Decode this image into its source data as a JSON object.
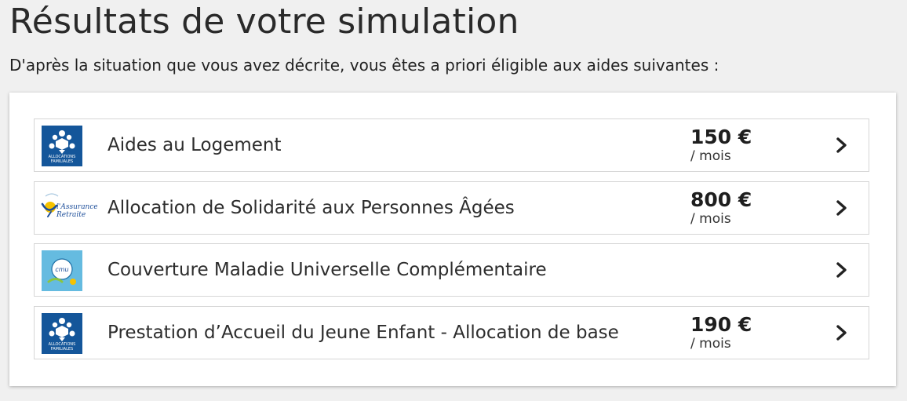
{
  "page": {
    "title": "Résultats de votre simulation",
    "subtitle": "D'après la situation que vous avez décrite, vous êtes a priori éligible aux aides suivantes :"
  },
  "aids": [
    {
      "name": "Aides au Logement",
      "amount": "150 €",
      "period": "/ mois",
      "logo": "caf-logo",
      "logo_text": "ALLOCATIONS FAMILIALES"
    },
    {
      "name": "Allocation de Solidarité aux Personnes Âgées",
      "amount": "800 €",
      "period": "/ mois",
      "logo": "assurance-retraite-logo",
      "logo_text_line1": "l'Assurance",
      "logo_text_line2": "Retraite"
    },
    {
      "name": "Couverture Maladie Universelle Complémentaire",
      "amount": "",
      "period": "",
      "logo": "cmu-logo",
      "logo_text": "cmu"
    },
    {
      "name": "Prestation d’Accueil du Jeune Enfant - Allocation de base",
      "amount": "190 €",
      "period": "/ mois",
      "logo": "caf-logo",
      "logo_text": "ALLOCATIONS FAMILIALES"
    }
  ],
  "icons": {
    "row_arrow": "chevron-right-icon"
  },
  "colors": {
    "caf_blue": "#14569a",
    "retraite_blue": "#1d4e9a",
    "background": "#f0f0f0",
    "card": "#ffffff",
    "row_border": "#d6d6d6"
  }
}
